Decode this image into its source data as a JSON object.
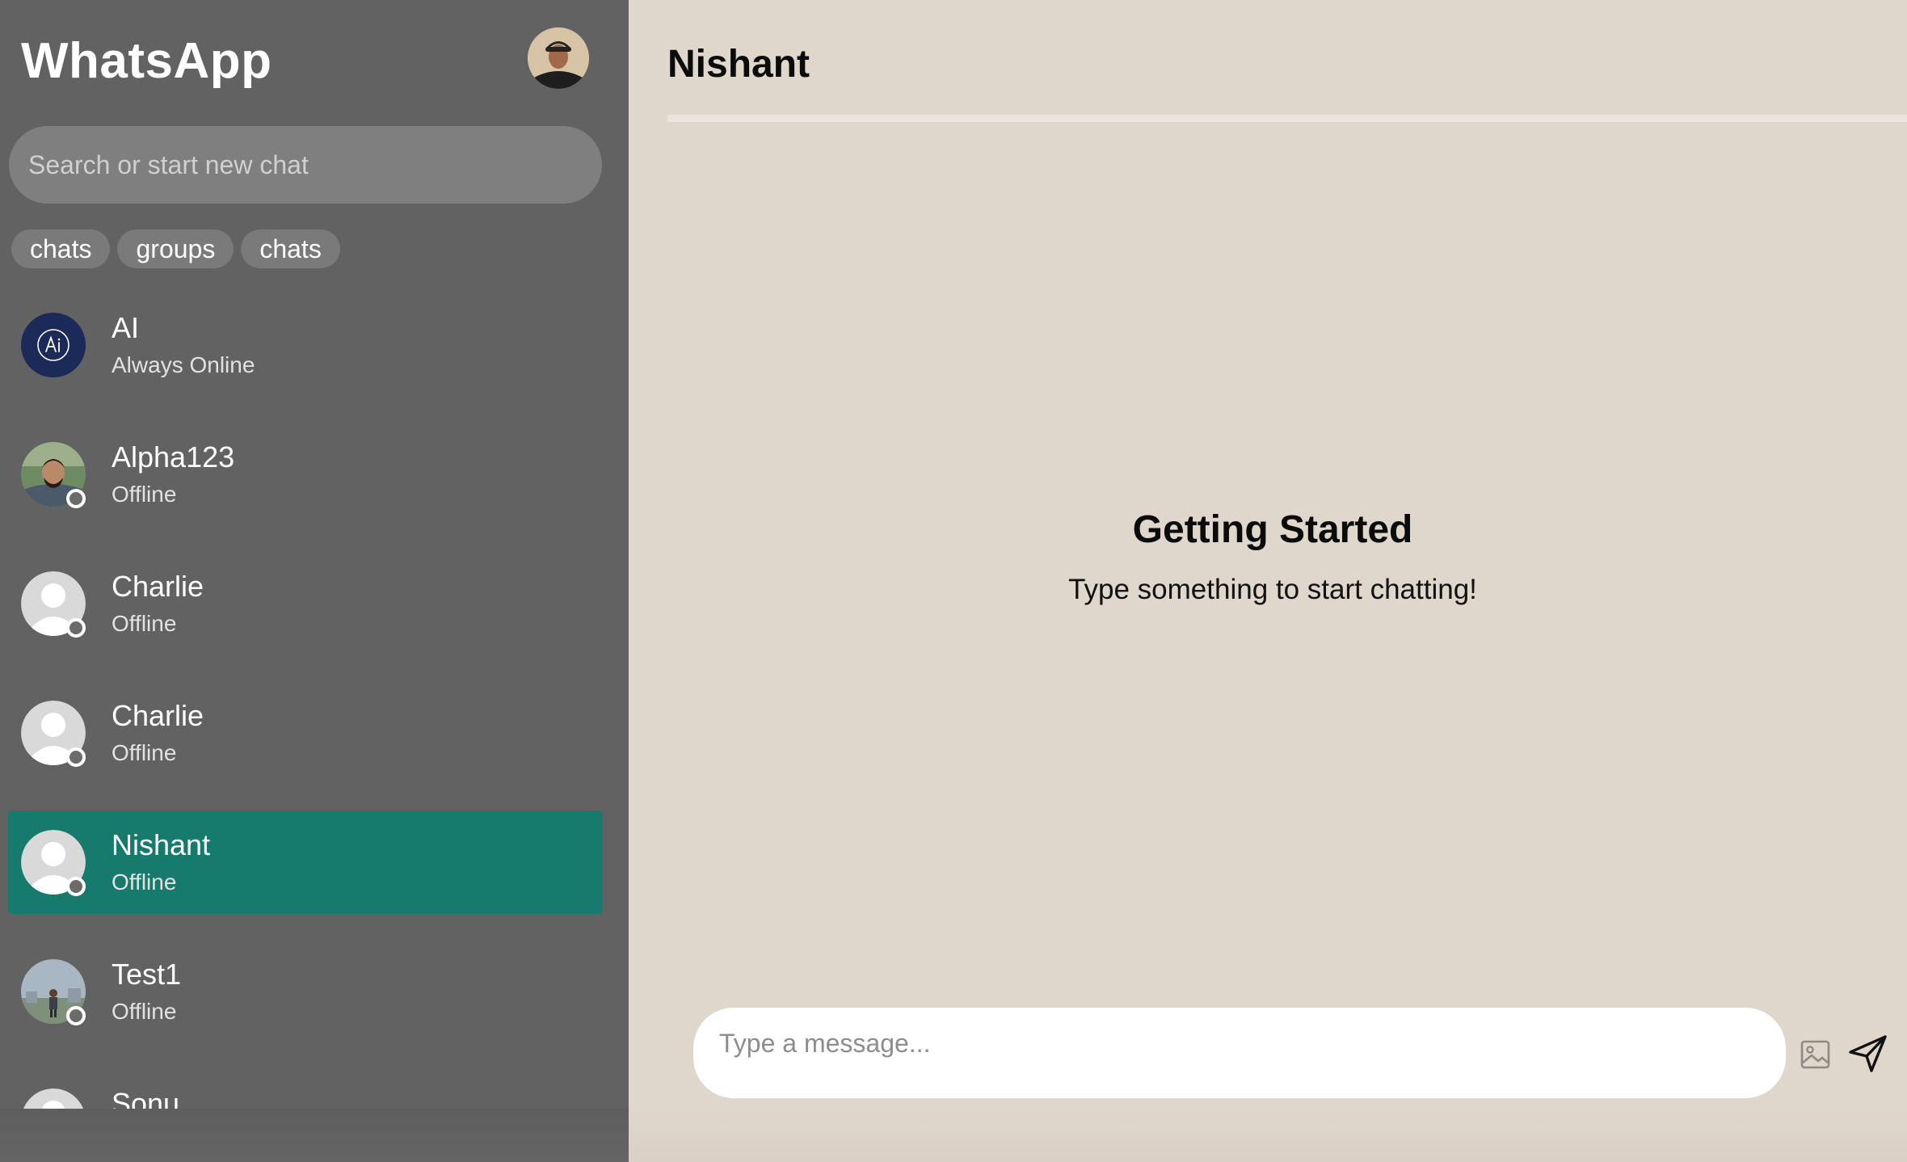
{
  "sidebar": {
    "app_title": "WhatsApp",
    "profile_avatar": "user-photo-icon",
    "search": {
      "placeholder": "Search or start new chat",
      "value": ""
    },
    "filters": [
      {
        "label": "chats"
      },
      {
        "label": "groups"
      },
      {
        "label": "chats"
      }
    ],
    "chats": [
      {
        "name": "AI",
        "status": "Always Online",
        "avatar": "ai-logo-icon",
        "active": false
      },
      {
        "name": "Alpha123",
        "status": "Offline",
        "avatar": "user-photo-icon",
        "active": false
      },
      {
        "name": "Charlie",
        "status": "Offline",
        "avatar": "default-user-icon",
        "active": false
      },
      {
        "name": "Charlie",
        "status": "Offline",
        "avatar": "default-user-icon",
        "active": false
      },
      {
        "name": "Nishant",
        "status": "Offline",
        "avatar": "default-user-icon",
        "active": true
      },
      {
        "name": "Test1",
        "status": "Offline",
        "avatar": "user-photo-icon",
        "active": false
      },
      {
        "name": "Sonu",
        "status": "",
        "avatar": "default-user-icon",
        "active": false
      }
    ]
  },
  "main": {
    "header_title": "Nishant",
    "empty_state": {
      "title": "Getting Started",
      "subtitle": "Type something to start chatting!"
    },
    "composer": {
      "placeholder": "Type a message...",
      "value": "",
      "image_icon": "image-icon",
      "send_icon": "send-icon"
    }
  },
  "colors": {
    "sidebar_bg": "#626262",
    "active_chat": "#167a6c",
    "main_bg": "#dfd6cc",
    "ai_avatar": "#1b2a58"
  }
}
